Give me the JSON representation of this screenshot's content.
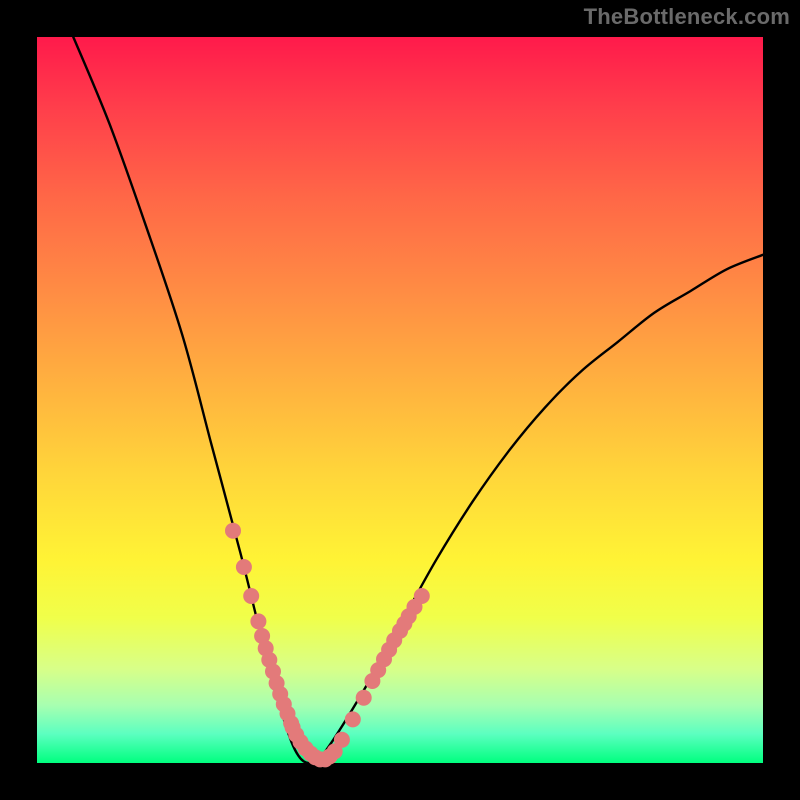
{
  "attribution": "TheBottleneck.com",
  "colors": {
    "frame": "#000000",
    "curve": "#000000",
    "markers": "#e37a7a",
    "gradient_top": "#ff1a4b",
    "gradient_bottom": "#00ff7f"
  },
  "chart_data": {
    "type": "line",
    "title": "",
    "xlabel": "",
    "ylabel": "",
    "xlim": [
      0,
      100
    ],
    "ylim": [
      0,
      100
    ],
    "x": [
      5,
      10,
      15,
      20,
      24,
      28,
      31,
      34,
      36,
      38,
      40,
      45,
      50,
      55,
      60,
      65,
      70,
      75,
      80,
      85,
      90,
      95,
      100
    ],
    "values": [
      100,
      88,
      74,
      59,
      44,
      29,
      17,
      6,
      1,
      0,
      2,
      10,
      19,
      28,
      36,
      43,
      49,
      54,
      58,
      62,
      65,
      68,
      70
    ],
    "series": [
      {
        "name": "bottleneck-curve",
        "x": [
          5,
          10,
          15,
          20,
          24,
          28,
          31,
          34,
          36,
          38,
          40,
          45,
          50,
          55,
          60,
          65,
          70,
          75,
          80,
          85,
          90,
          95,
          100
        ],
        "y": [
          100,
          88,
          74,
          59,
          44,
          29,
          17,
          6,
          1,
          0,
          2,
          10,
          19,
          28,
          36,
          43,
          49,
          54,
          58,
          62,
          65,
          68,
          70
        ]
      }
    ],
    "markers": {
      "name": "highlighted-points",
      "x": [
        27,
        28.5,
        29.5,
        30.5,
        31,
        31.5,
        32,
        32.5,
        33,
        33.5,
        34,
        34.5,
        35,
        35.2,
        35.7,
        36.3,
        37,
        37.7,
        38.3,
        39,
        39.7,
        40.3,
        41,
        42,
        43.5,
        45,
        46.2,
        47,
        47.8,
        48.5,
        49.2,
        50,
        50.6,
        51.2,
        52,
        53
      ],
      "y": [
        32,
        27,
        23,
        19.5,
        17.5,
        15.8,
        14.2,
        12.6,
        11,
        9.5,
        8.1,
        6.8,
        5.5,
        4.9,
        3.9,
        2.9,
        2,
        1.3,
        0.8,
        0.5,
        0.5,
        0.9,
        1.6,
        3.2,
        6,
        9,
        11.3,
        12.8,
        14.3,
        15.6,
        16.9,
        18.2,
        19.2,
        20.2,
        21.5,
        23
      ]
    }
  }
}
